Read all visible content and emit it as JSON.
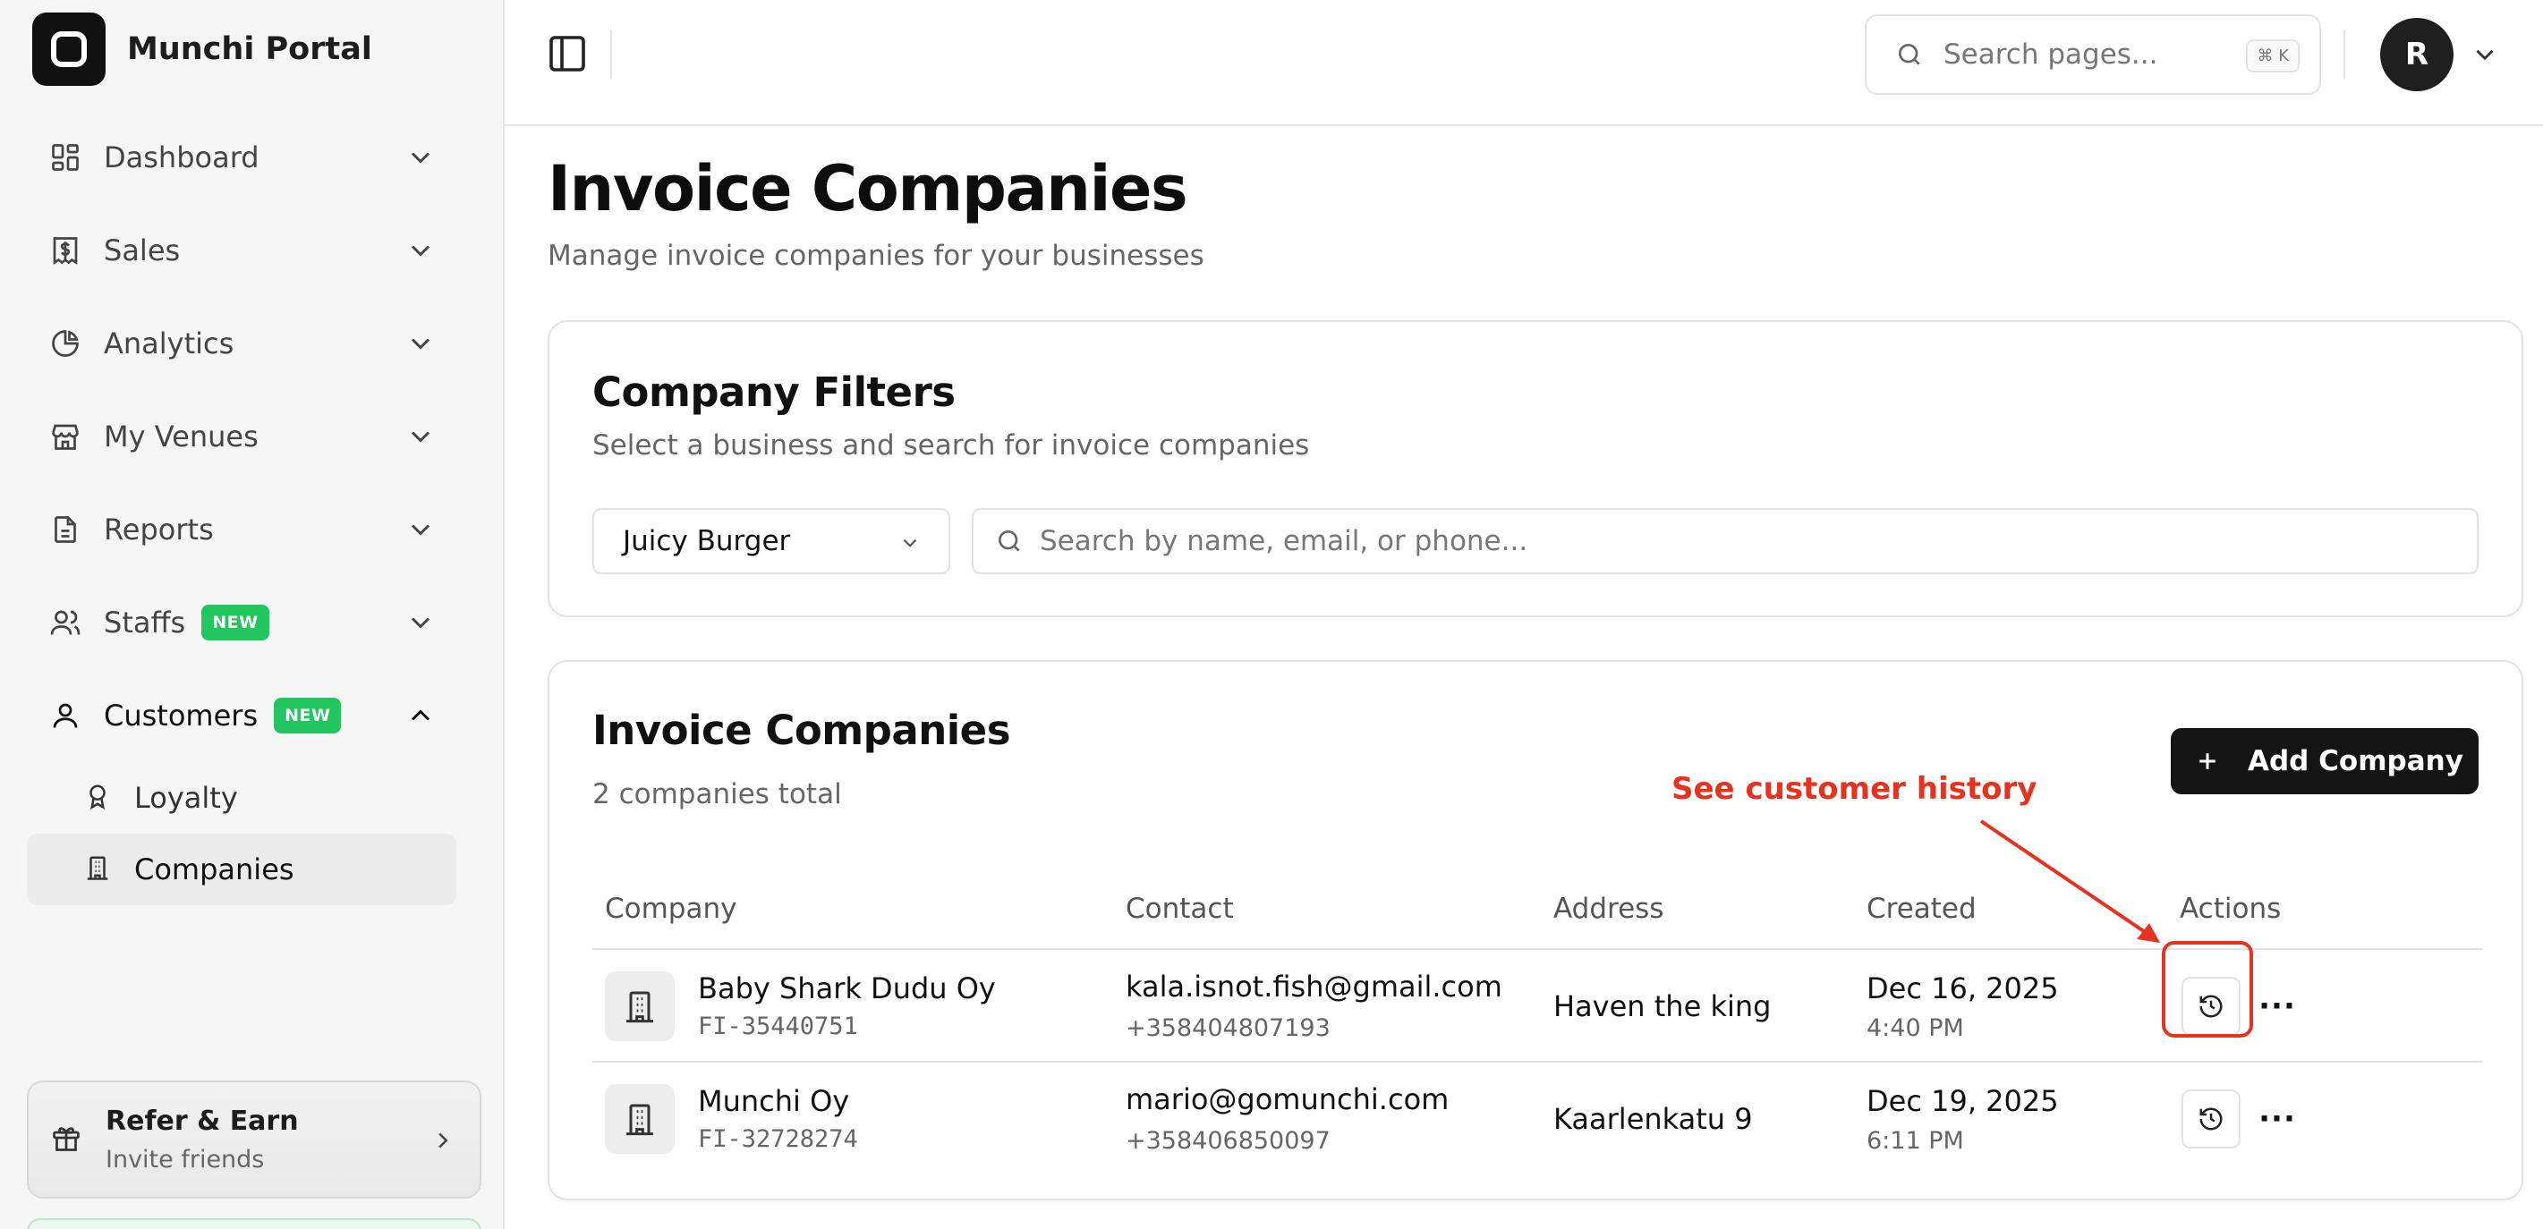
{
  "app": {
    "name": "Munchi Portal"
  },
  "sidebar": {
    "items": [
      {
        "label": "Dashboard",
        "icon": "dashboard-icon"
      },
      {
        "label": "Sales",
        "icon": "receipt-dollar-icon"
      },
      {
        "label": "Analytics",
        "icon": "pie-chart-icon"
      },
      {
        "label": "My Venues",
        "icon": "store-icon"
      },
      {
        "label": "Reports",
        "icon": "document-icon"
      },
      {
        "label": "Staffs",
        "icon": "users-icon",
        "badge": "NEW"
      },
      {
        "label": "Customers",
        "icon": "user-icon",
        "badge": "NEW"
      }
    ],
    "subitems": [
      {
        "label": "Loyalty",
        "icon": "award-icon"
      },
      {
        "label": "Companies",
        "icon": "building-icon"
      }
    ],
    "refer": {
      "title": "Refer & Earn",
      "subtitle": "Invite friends"
    }
  },
  "topbar": {
    "search_placeholder": "Search pages...",
    "shortcut": "⌘ K",
    "avatar_initial": "R"
  },
  "page": {
    "title": "Invoice Companies",
    "subtitle": "Manage invoice companies for your businesses"
  },
  "filters": {
    "title": "Company Filters",
    "subtitle": "Select a business and search for invoice companies",
    "business_value": "Juicy Burger",
    "search_placeholder": "Search by name, email, or phone..."
  },
  "companies": {
    "title": "Invoice Companies",
    "count_text": "2 companies total",
    "add_label": "Add Company",
    "columns": [
      "Company",
      "Contact",
      "Address",
      "Created",
      "Actions"
    ],
    "rows": [
      {
        "name": "Baby Shark Dudu Oy",
        "id": "FI-35440751",
        "email": "kala.isnot.fish@gmail.com",
        "phone": "+358404807193",
        "address": "Haven the king",
        "date": "Dec 16, 2025",
        "time": "4:40 PM"
      },
      {
        "name": "Munchi Oy",
        "id": "FI-32728274",
        "email": "mario@gomunchi.com",
        "phone": "+358406850097",
        "address": "Kaarlenkatu 9",
        "date": "Dec 19, 2025",
        "time": "6:11 PM"
      }
    ]
  },
  "annotation": {
    "text": "See customer history",
    "color": "#e8321f"
  },
  "colors": {
    "badge_green": "#22c55e",
    "primary_button": "#141414"
  }
}
